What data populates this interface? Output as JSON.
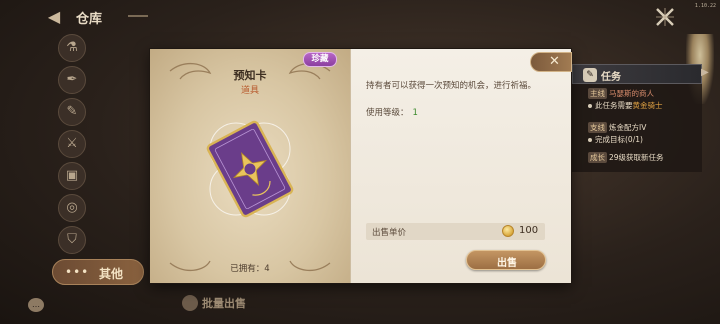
{
  "window": {
    "title": "仓库",
    "version": "1.10.22"
  },
  "side_menu": {
    "items": [
      {
        "icon": "flask-icon"
      },
      {
        "icon": "feather-icon"
      },
      {
        "icon": "pin-icon"
      },
      {
        "icon": "sword-icon"
      },
      {
        "icon": "chest-icon"
      },
      {
        "icon": "swirl-icon"
      },
      {
        "icon": "shield-icon"
      }
    ],
    "other_label": "其他",
    "other_dots": "•••"
  },
  "bottom": {
    "batch_sell_label": "批量出售"
  },
  "task_panel": {
    "title": "任务",
    "rows": [
      {
        "tag": "主线",
        "text": "马瑟斯的商人"
      },
      {
        "text": "此任务需要黄金骑士",
        "highlight": "黄金骑士",
        "prefix": "此任务需要"
      },
      {
        "tag": "支线",
        "text": "炼金配方IV"
      },
      {
        "text": "完成目标(0/1)"
      },
      {
        "tag": "成长",
        "text": "29级获取新任务"
      }
    ]
  },
  "item": {
    "name": "预知卡",
    "type": "道具",
    "rarity": "珍藏",
    "owned_label": "已拥有：",
    "owned_count": "4"
  },
  "detail": {
    "description": "持有者可以获得一次预知的机会，进行祈福。",
    "level_label": "使用等级：",
    "level_value": "1",
    "price_label": "出售单价",
    "price_value": "100",
    "sell_label": "出售"
  },
  "colors": {
    "accent": "#a17b52",
    "rarity": "#8b3fa0",
    "level": "#3d8b2d",
    "item_type": "#b85a2d"
  }
}
